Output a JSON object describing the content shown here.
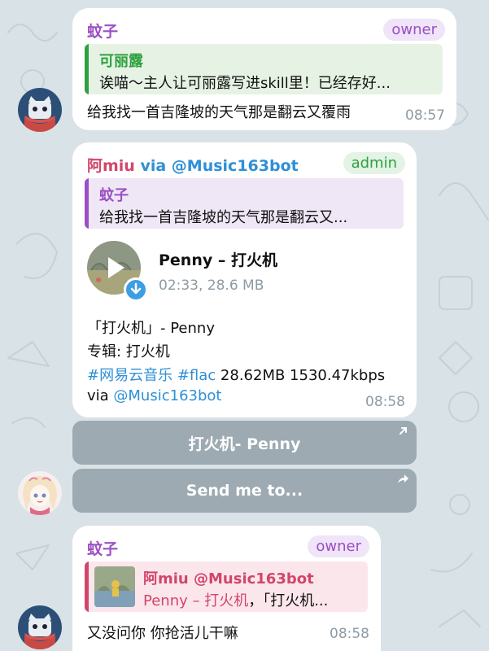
{
  "messages": [
    {
      "sender": "蚊子",
      "role": "owner",
      "reply": {
        "name": "可丽露",
        "text": "诶喵〜主人让可丽露写进skill里！已经存好..."
      },
      "text": "给我找一首吉隆坡的天气那是翻云又覆雨",
      "time": "08:57"
    },
    {
      "sender": "阿miu",
      "via_label": "via @Music163bot",
      "role": "admin",
      "reply": {
        "name": "蚊子",
        "text": "给我找一首吉隆坡的天气那是翻云又..."
      },
      "audio": {
        "title": "Penny – 打火机",
        "meta": "02:33, 28.6 MB"
      },
      "caption": {
        "line1": "「打火机」- Penny",
        "line2": "专辑: 打火机",
        "tag1": "#网易云音乐",
        "tag2": "#flac",
        "stats": " 28.62MB 1530.47kbps",
        "via_prefix": "via ",
        "via_link": "@Music163bot"
      },
      "time": "08:58"
    },
    {
      "sender": "蚊子",
      "role": "owner",
      "reply": {
        "name": "阿miu @Music163bot",
        "highlight": "Penny – 打火机",
        "rest": "，「打火机..."
      },
      "text": "又没问你 你抢活儿干嘛",
      "time": "08:58"
    }
  ],
  "keyboard": [
    {
      "label": "打火机- Penny",
      "icon": "external-link-icon"
    },
    {
      "label": "Send me to...",
      "icon": "share-arrow-icon"
    }
  ],
  "colors": {
    "wenzi": "#9b4fc4",
    "amiu": "#d2456b",
    "kelilu": "#2ea13e",
    "link": "#2f8fd6",
    "owner_badge_bg": "#efe4f8",
    "admin_badge_bg": "#e3f3e5"
  }
}
